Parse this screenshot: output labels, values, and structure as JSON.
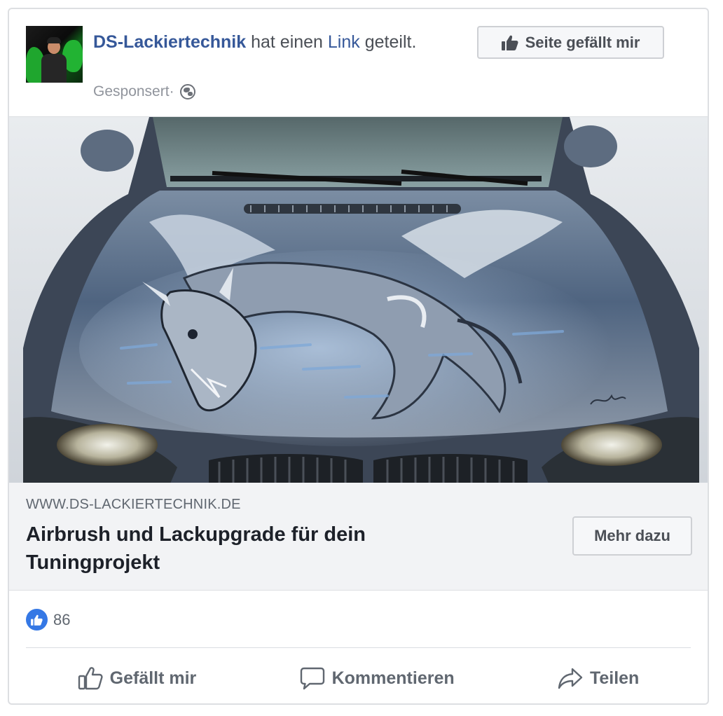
{
  "post": {
    "page_name": "DS-Lackiertechnik",
    "action_text_1": " hat einen ",
    "link_word": "Link",
    "action_text_2": " geteilt.",
    "sponsored_label": "Gesponsert",
    "separator": " · ",
    "like_page_button": "Seite gefällt mir",
    "icons": {
      "avatar": "page-avatar",
      "audience": "globe-icon",
      "like_page": "thumbs-up-icon"
    }
  },
  "link_preview": {
    "domain": "WWW.DS-LACKIERTECHNIK.DE",
    "title": "Airbrush und Lackupgrade für dein Tuningprojekt",
    "cta_button": "Mehr dazu",
    "image_alt_subject": "car hood with airbrushed dragon"
  },
  "engagement": {
    "like_count": "86",
    "like_reaction_color": "#3578e5"
  },
  "actions": {
    "like": "Gefällt mir",
    "comment": "Kommentieren",
    "share": "Teilen"
  },
  "colors": {
    "link_blue": "#365899",
    "meta_gray": "#90949c",
    "border": "#dddfe2",
    "linkbox_bg": "#f2f3f5"
  }
}
